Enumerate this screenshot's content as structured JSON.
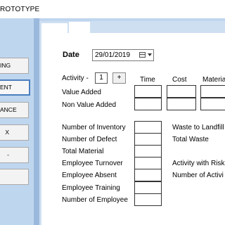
{
  "window": {
    "title": "ROTOTYPE"
  },
  "sidebar": {
    "items": [
      {
        "label": "ING",
        "active": false
      },
      {
        "label": "ENT",
        "active": true
      },
      {
        "label": "ANCE",
        "active": false
      },
      {
        "label": "X",
        "active": false
      },
      {
        "label": "-",
        "active": false
      },
      {
        "label": "",
        "active": false
      }
    ]
  },
  "form": {
    "date_label": "Date",
    "date_value": "29/01/2019",
    "activity_label": "Activity -",
    "activity_value": "1",
    "plus_label": "+",
    "col_time": "Time",
    "col_cost": "Cost",
    "col_material": "Materia",
    "value_added": "Value Added",
    "non_value_added": "Non Value Added",
    "left_fields": [
      "Number of Inventory",
      "Number of Defect",
      "Total Material",
      "Employee Turnover",
      "Employee Absent",
      "Employee Training",
      "Number of Employee"
    ],
    "right_labels": [
      "Waste to Landfill",
      "Total Waste",
      "Activity with Risk",
      "Number of Activi"
    ]
  },
  "colors": {
    "background": "#bfd6ef",
    "accent": "#4a7fc0"
  }
}
